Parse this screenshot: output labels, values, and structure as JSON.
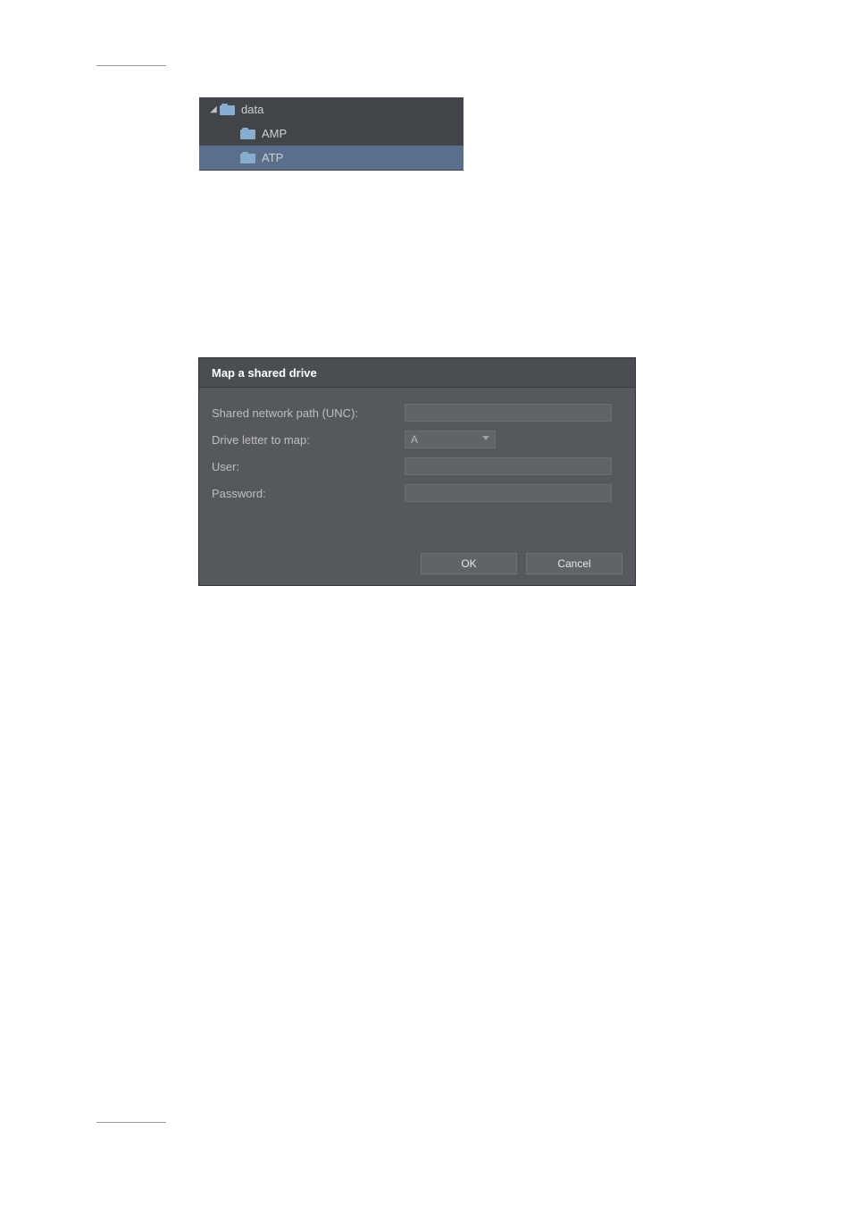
{
  "tree": {
    "root_label": "data",
    "children": [
      {
        "label": "AMP"
      },
      {
        "label": "ATP"
      }
    ]
  },
  "dialog": {
    "title": "Map a shared drive",
    "labels": {
      "unc": "Shared network path (UNC):",
      "drive": "Drive letter to map:",
      "user": "User:",
      "password": "Password:"
    },
    "drive_selected": "A",
    "buttons": {
      "ok": "OK",
      "cancel": "Cancel"
    }
  }
}
